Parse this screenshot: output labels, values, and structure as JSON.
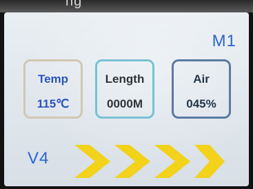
{
  "top_band": {
    "text": "ng"
  },
  "mode": "M1",
  "cards": [
    {
      "label": "Temp",
      "value": "115℃"
    },
    {
      "label": "Length",
      "value": "0000M"
    },
    {
      "label": "Air",
      "value": "045%"
    }
  ],
  "footer": {
    "version": "V4",
    "arrow_count": 4,
    "arrow_icon": "chevron-right-icon",
    "arrow_color": "#f2d21a"
  },
  "colors": {
    "accent": "#2c63d6",
    "screen_background": "#e9eef2"
  }
}
